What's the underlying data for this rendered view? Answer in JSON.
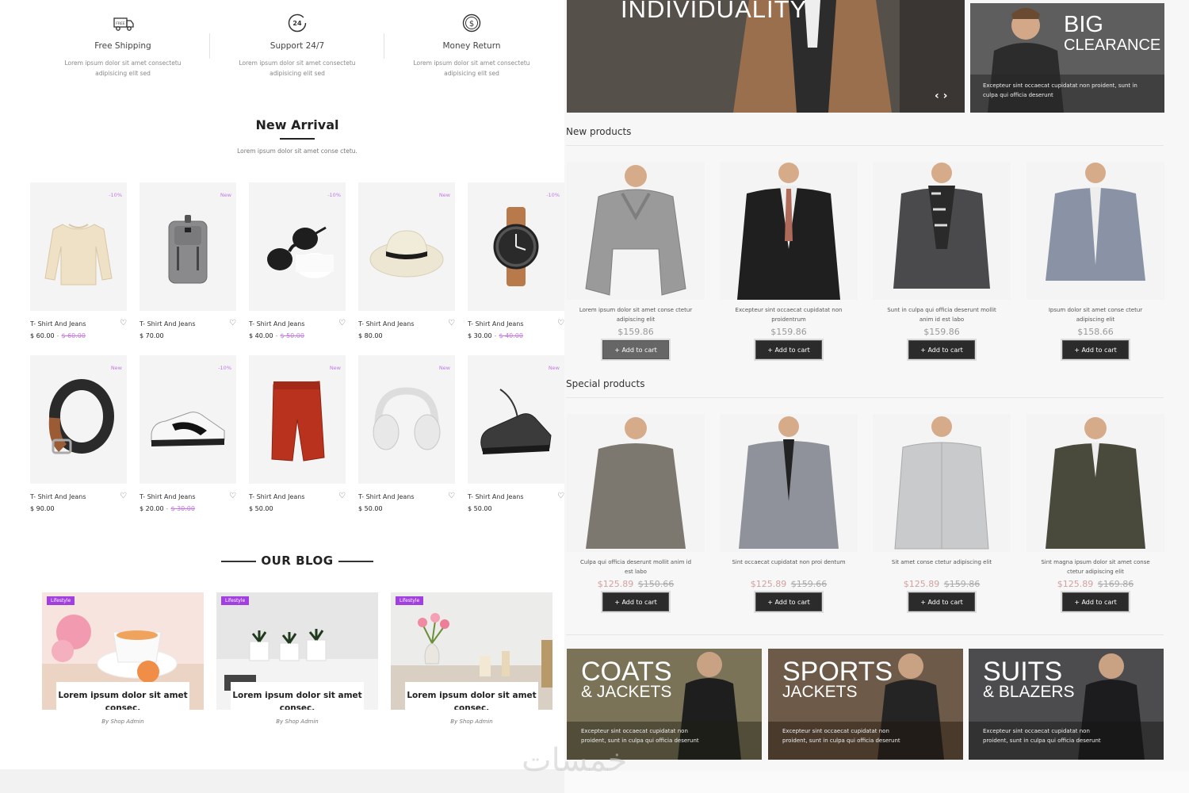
{
  "features": [
    {
      "icon": "free-shipping-truck-icon",
      "icon_text": "FREE",
      "title": "Free Shipping",
      "desc": "Lorem ipsum dolor sit amet consectetu adipisicing elit sed"
    },
    {
      "icon": "support-24-icon",
      "icon_text": "24",
      "title": "Support 24/7",
      "desc": "Lorem ipsum dolor sit amet consectetu adipisicing elit sed"
    },
    {
      "icon": "money-return-icon",
      "icon_text": "$",
      "title": "Money Return",
      "desc": "Lorem ipsum dolor sit amet consectetu adipisicing elit sed"
    }
  ],
  "new_arrival": {
    "title": "New Arrival",
    "subtitle": "Lorem ipsum dolor sit amet conse ctetu.",
    "products": [
      {
        "name": "T- Shirt And Jeans",
        "badge": "-10%",
        "price": "$ 60.00",
        "old_price": "$ 60.00",
        "image": "sweater"
      },
      {
        "name": "T- Shirt And Jeans",
        "badge": "New",
        "price": "$ 70.00",
        "old_price": "",
        "image": "backpack"
      },
      {
        "name": "T- Shirt And Jeans",
        "badge": "-10%",
        "price": "$ 40.00",
        "old_price": "$ 50.00",
        "image": "sunglasses"
      },
      {
        "name": "T- Shirt And Jeans",
        "badge": "New",
        "price": "$ 80.00",
        "old_price": "",
        "image": "hat"
      },
      {
        "name": "T- Shirt And Jeans",
        "badge": "-10%",
        "price": "$ 30.00",
        "old_price": "$ 40.00",
        "image": "watch"
      },
      {
        "name": "T- Shirt And Jeans",
        "badge": "New",
        "price": "$ 90.00",
        "old_price": "",
        "image": "belt"
      },
      {
        "name": "T- Shirt And Jeans",
        "badge": "-10%",
        "price": "$ 20.00",
        "old_price": "$ 30.00",
        "image": "sneaker"
      },
      {
        "name": "T- Shirt And Jeans",
        "badge": "New",
        "price": "$ 50.00",
        "old_price": "",
        "image": "shorts"
      },
      {
        "name": "T- Shirt And Jeans",
        "badge": "New",
        "price": "$ 50.00",
        "old_price": "",
        "image": "headphones"
      },
      {
        "name": "T- Shirt And Jeans",
        "badge": "New",
        "price": "$ 50.00",
        "old_price": "",
        "image": "running-shoe"
      }
    ]
  },
  "blog": {
    "title": "OUR BLOG",
    "posts": [
      {
        "tag": "Lifestyle",
        "title": "Lorem ipsum dolor sit amet consec.",
        "by": "By Shop Admin",
        "image": "tea-flowers"
      },
      {
        "tag": "Lifestyle",
        "title": "Lorem ipsum dolor sit amet consec.",
        "by": "By Shop Admin",
        "image": "plants-desk"
      },
      {
        "tag": "Lifestyle",
        "title": "Lorem ipsum dolor sit amet consec.",
        "by": "By Shop Admin",
        "image": "tulips-vase"
      }
    ]
  },
  "hero": {
    "main_title": "INDIVIDUALITY",
    "arrows": "‹ ›",
    "side_title_1": "BIG",
    "side_title_2": "CLEARANCE",
    "side_desc": "Excepteur sint occaecat cupidatat non proident, sunt in culpa qui officia deserunt"
  },
  "new_products": {
    "title": "New products",
    "items": [
      {
        "desc": "Lorem ipsum dolor sit amet conse ctetur adipiscing elit",
        "price": "$159.86",
        "cta": "+ Add to cart",
        "image": "grey-sweater"
      },
      {
        "desc": "Excepteur sint occaecat cupidatat non proidentrum",
        "price": "$159.86",
        "cta": "+ Add to cart",
        "image": "black-blazer"
      },
      {
        "desc": "Sunt in culpa qui officia deserunt mollit anim id est labo",
        "price": "$159.86",
        "cta": "+ Add to cart",
        "image": "scarf-blazer"
      },
      {
        "desc": "Ipsum dolor sit amet conse ctetur adipiscing elit",
        "price": "$158.66",
        "cta": "+ Add to cart",
        "image": "grey-jacket"
      }
    ]
  },
  "special_products": {
    "title": "Special products",
    "items": [
      {
        "desc": "Culpa qui officia deserunt mollit anim id est labo",
        "price": "$125.89",
        "old_price": "$150.66",
        "cta": "+ Add to cart",
        "image": "henley"
      },
      {
        "desc": "Sint occaecat cupidatat non proi dentum",
        "price": "$125.89",
        "old_price": "$159.66",
        "cta": "+ Add to cart",
        "image": "grey-suit"
      },
      {
        "desc": "Sit amet conse ctetur adipiscing elit",
        "price": "$125.89",
        "old_price": "$159.86",
        "cta": "+ Add to cart",
        "image": "light-shirt"
      },
      {
        "desc": "Sint magna ipsum dolor sit amet conse ctetur adipiscing elit",
        "price": "$125.89",
        "old_price": "$169.86",
        "cta": "+ Add to cart",
        "image": "olive-jacket"
      }
    ]
  },
  "banners": [
    {
      "title_1": "COATS",
      "title_2": "& JACKETS",
      "desc": "Excepteur sint occaecat cupidatat non proident, sunt in culpa qui officia deserunt",
      "color": "#7a7358"
    },
    {
      "title_1": "SPORTS",
      "title_2": "JACKETS",
      "desc": "Excepteur sint occaecat cupidatat non proident, sunt in culpa qui officia deserunt",
      "color": "#6e5a48"
    },
    {
      "title_1": "SUITS",
      "title_2": "& BLAZERS",
      "desc": "Excepteur sint occaecat cupidatat non proident, sunt in culpa qui officia deserunt",
      "color": "#4c4c4e"
    }
  ],
  "watermark": "خمسات",
  "colors": {
    "accent": "#c17ae0",
    "tag": "#a23fe0",
    "button": "#2b2b2b"
  }
}
